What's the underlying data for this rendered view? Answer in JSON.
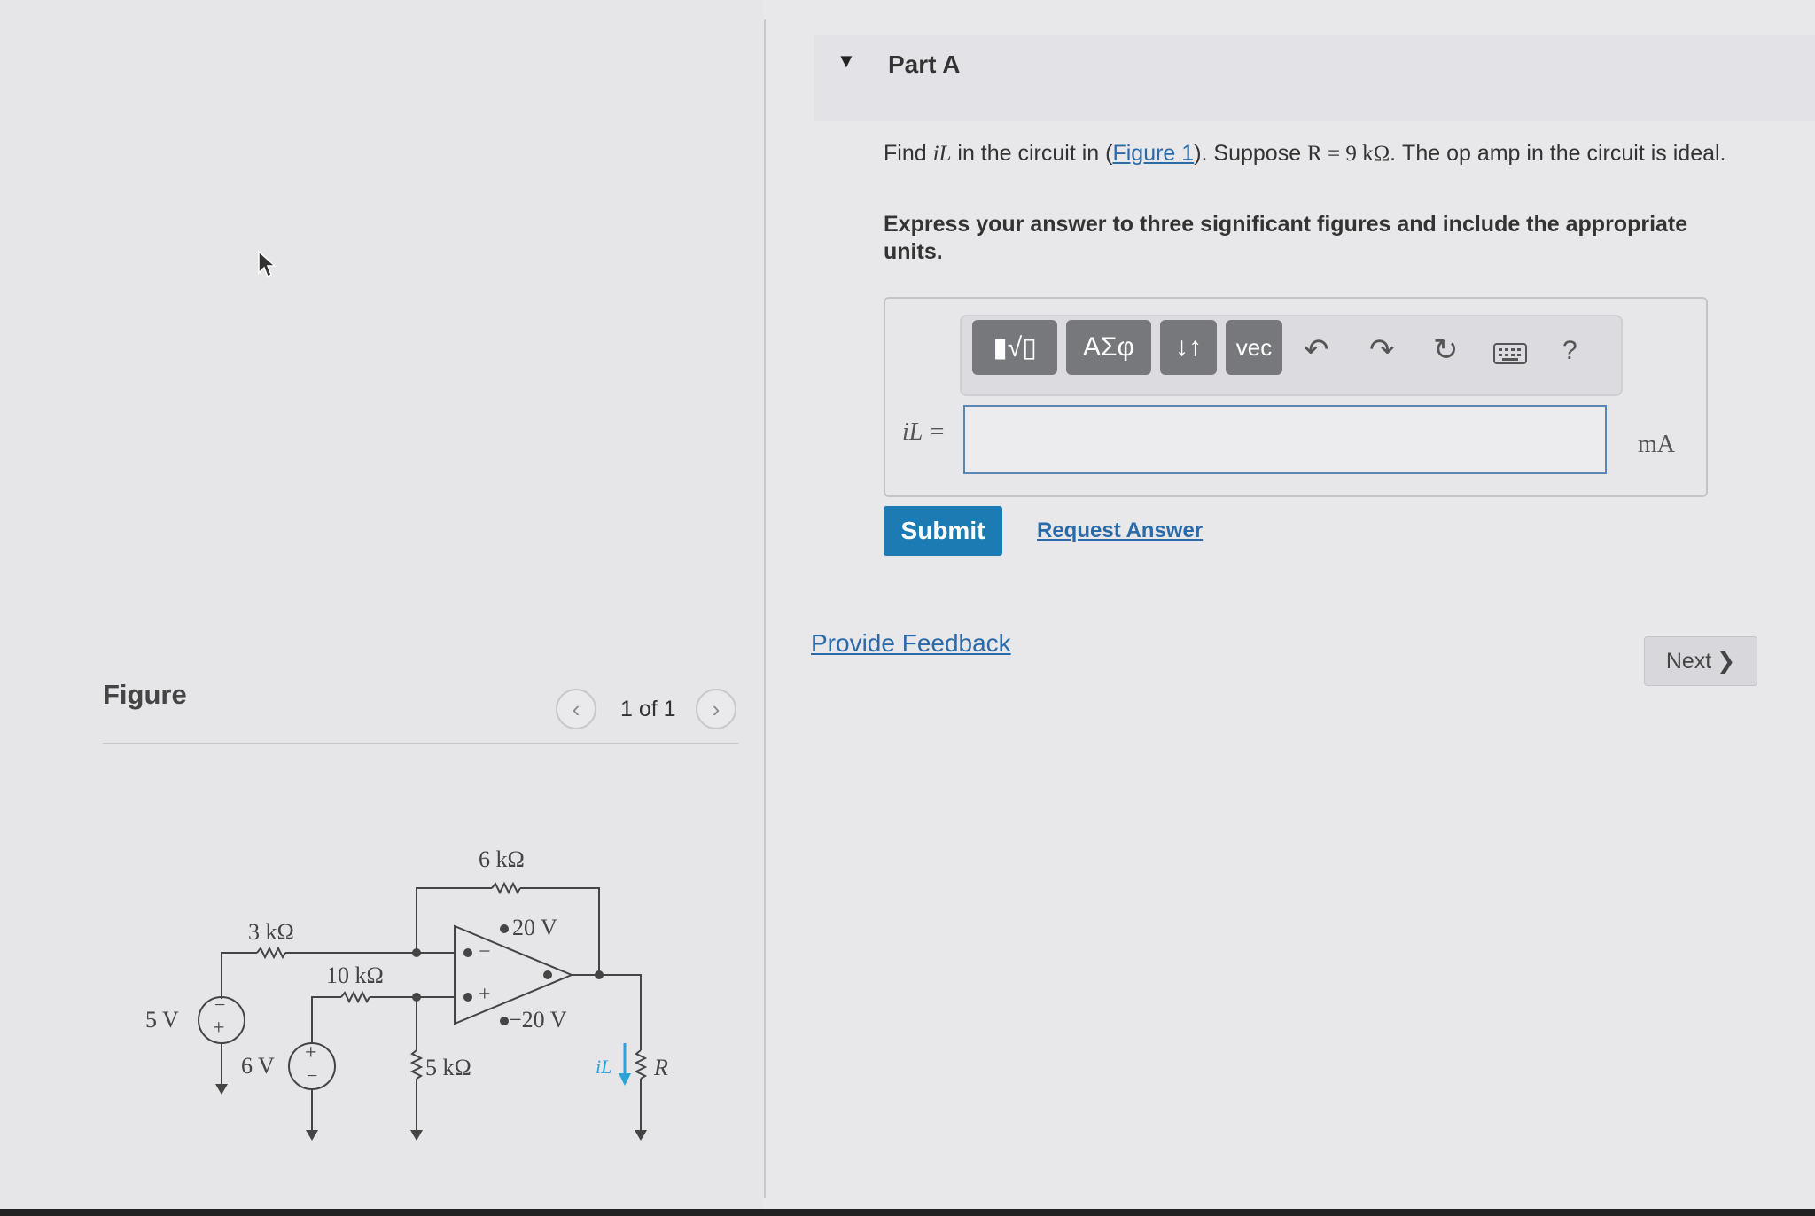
{
  "figure_panel": {
    "title": "Figure",
    "counter": "1 of 1",
    "prev_icon": "chevron-left",
    "next_icon": "chevron-right",
    "circuit_labels": {
      "r_feedback": "6 kΩ",
      "r_3k": "3 kΩ",
      "r_10k": "10 kΩ",
      "r_5k": "5 kΩ",
      "v_pos_supply": "20 V",
      "v_neg_supply": "−20 V",
      "src_5v": "5 V",
      "src_6v": "6 V",
      "current_label": "iL",
      "load_label": "R"
    }
  },
  "part": {
    "title": "Part A",
    "toggle_icon": "caret-down"
  },
  "question": {
    "text_before": "Find ",
    "var": "iL",
    "text_mid": " in the circuit in (",
    "link": "Figure 1",
    "text_after": "). Suppose ",
    "math": "R = 9  kΩ",
    "text_end": ". The op amp in the circuit is ideal.",
    "instruction": "Express your answer to three significant figures and include the appropriate units."
  },
  "toolbar": {
    "templates_label": "▮√▯",
    "greek_label": "ΑΣφ",
    "arrows_label": "↓↑",
    "vec_label": "vec",
    "undo_icon": "undo-arrow",
    "redo_icon": "redo-arrow",
    "reset_icon": "reset-circular-arrow",
    "keyboard_icon": "keyboard",
    "help_label": "?"
  },
  "answer": {
    "lhs": "iL =",
    "value": "",
    "unit": "mA"
  },
  "actions": {
    "submit": "Submit",
    "request_answer": "Request Answer",
    "provide_feedback": "Provide Feedback",
    "next": "Next"
  }
}
